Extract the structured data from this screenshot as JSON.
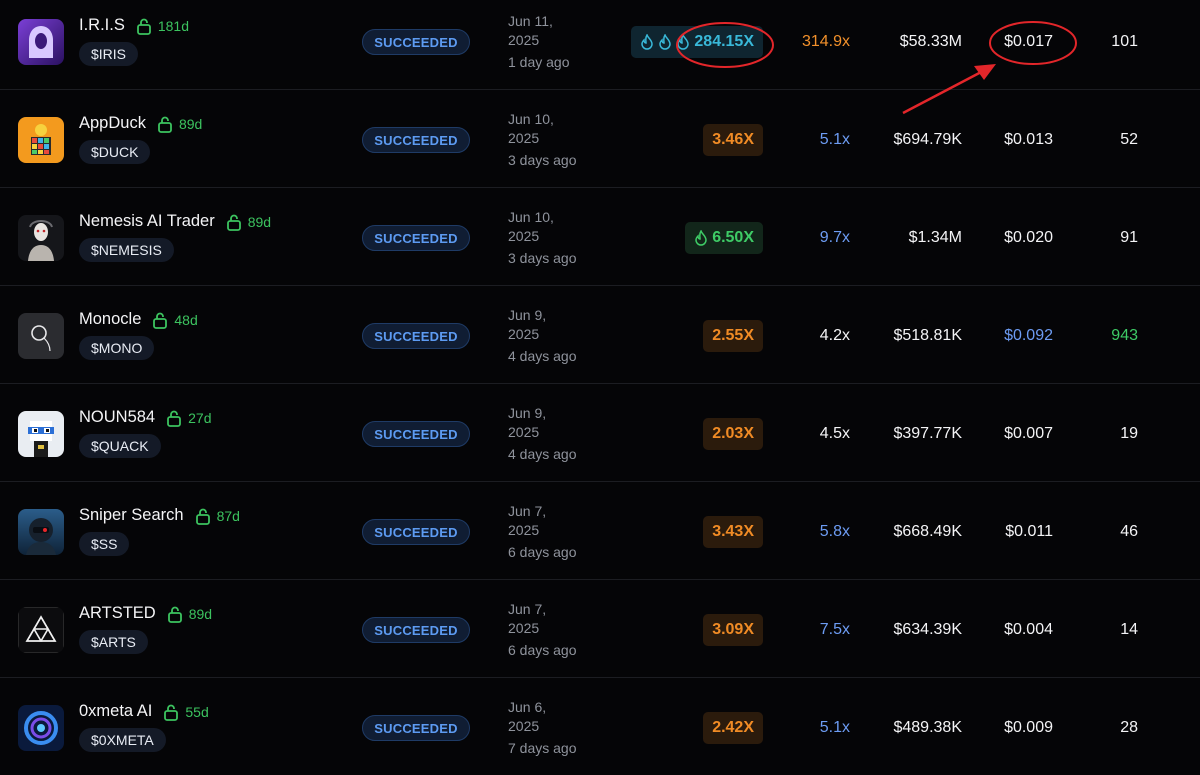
{
  "rows": [
    {
      "name": "I.R.I.S",
      "age": "181d",
      "ticker": "$IRIS",
      "status": "SUCCEEDED",
      "date_line1": "Jun 11,",
      "date_line2": "2025",
      "ago": "1 day ago",
      "multiplier": "284.15X",
      "mult_style": "teal",
      "flames": 3,
      "ath": "314.9x",
      "ath_color": "orange",
      "mcap": "$58.33M",
      "price": "$0.017",
      "price_color": "white",
      "count": "101",
      "count_color": "white",
      "avatar": "iris-hooded-figure"
    },
    {
      "name": "AppDuck",
      "age": "89d",
      "ticker": "$DUCK",
      "status": "SUCCEEDED",
      "date_line1": "Jun 10,",
      "date_line2": "2025",
      "ago": "3 days ago",
      "multiplier": "3.46X",
      "mult_style": "orange",
      "flames": 0,
      "ath": "5.1x",
      "ath_color": "blue",
      "mcap": "$694.79K",
      "price": "$0.013",
      "price_color": "white",
      "count": "52",
      "count_color": "white",
      "avatar": "duck-rubik-cube"
    },
    {
      "name": "Nemesis AI Trader",
      "age": "89d",
      "ticker": "$NEMESIS",
      "status": "SUCCEEDED",
      "date_line1": "Jun 10,",
      "date_line2": "2025",
      "ago": "3 days ago",
      "multiplier": "6.50X",
      "mult_style": "green",
      "flames": 1,
      "ath": "9.7x",
      "ath_color": "blue",
      "mcap": "$1.34M",
      "price": "$0.020",
      "price_color": "white",
      "count": "91",
      "count_color": "white",
      "avatar": "android-portrait"
    },
    {
      "name": "Monocle",
      "age": "48d",
      "ticker": "$MONO",
      "status": "SUCCEEDED",
      "date_line1": "Jun 9,",
      "date_line2": "2025",
      "ago": "4 days ago",
      "multiplier": "2.55X",
      "mult_style": "orange",
      "flames": 0,
      "ath": "4.2x",
      "ath_color": "white",
      "mcap": "$518.81K",
      "price": "$0.092",
      "price_color": "blue",
      "count": "943",
      "count_color": "green",
      "avatar": "monocle-lens"
    },
    {
      "name": "NOUN584",
      "age": "27d",
      "ticker": "$QUACK",
      "status": "SUCCEEDED",
      "date_line1": "Jun 9,",
      "date_line2": "2025",
      "ago": "4 days ago",
      "multiplier": "2.03X",
      "mult_style": "orange",
      "flames": 0,
      "ath": "4.5x",
      "ath_color": "white",
      "mcap": "$397.77K",
      "price": "$0.007",
      "price_color": "white",
      "count": "19",
      "count_color": "white",
      "avatar": "pixel-noun-duck"
    },
    {
      "name": "Sniper Search",
      "age": "87d",
      "ticker": "$SS",
      "status": "SUCCEEDED",
      "date_line1": "Jun 7,",
      "date_line2": "2025",
      "ago": "6 days ago",
      "multiplier": "3.43X",
      "mult_style": "orange",
      "flames": 0,
      "ath": "5.8x",
      "ath_color": "blue",
      "mcap": "$668.49K",
      "price": "$0.011",
      "price_color": "white",
      "count": "46",
      "count_color": "white",
      "avatar": "sniper-helmet"
    },
    {
      "name": "ARTSTED",
      "age": "89d",
      "ticker": "$ARTS",
      "status": "SUCCEEDED",
      "date_line1": "Jun 7,",
      "date_line2": "2025",
      "ago": "6 days ago",
      "multiplier": "3.09X",
      "mult_style": "orange",
      "flames": 0,
      "ath": "7.5x",
      "ath_color": "blue",
      "mcap": "$634.39K",
      "price": "$0.004",
      "price_color": "white",
      "count": "14",
      "count_color": "white",
      "avatar": "triangle-logo"
    },
    {
      "name": "0xmeta AI",
      "age": "55d",
      "ticker": "$0XMETA",
      "status": "SUCCEEDED",
      "date_line1": "Jun 6,",
      "date_line2": "2025",
      "ago": "7 days ago",
      "multiplier": "2.42X",
      "mult_style": "orange",
      "flames": 0,
      "ath": "5.1x",
      "ath_color": "blue",
      "mcap": "$489.38K",
      "price": "$0.009",
      "price_color": "white",
      "count": "28",
      "count_color": "white",
      "avatar": "blue-ring-orb"
    }
  ],
  "colors": {
    "orange": "#f3912b",
    "blue": "#6d9cf3",
    "white": "#f4f4f6",
    "green": "#3ecb66",
    "annotation_red": "#e3262a"
  }
}
